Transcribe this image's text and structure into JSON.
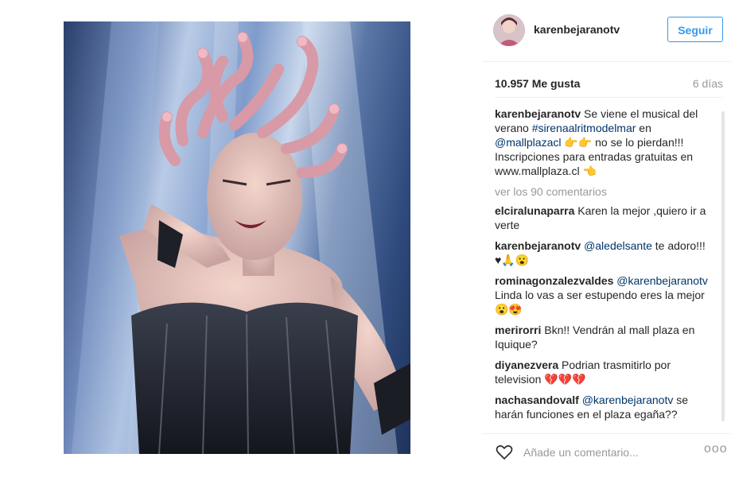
{
  "post": {
    "image_alt": "",
    "author": "karenbejaranotv",
    "follow_label": "Seguir",
    "likes": "10.957 Me gusta",
    "time": "6 días",
    "caption": {
      "user": "karenbejaranotv",
      "t1": " Se viene el musical del verano ",
      "hashtag": "#sirenaalritmodelmar",
      "t2": " en ",
      "mention": "@mallplazacl",
      "t3": " 👉👉 no se lo pierdan!!! Inscripciones para entradas gratuitas en www.mallplaza.cl 👈"
    },
    "view_more": "ver los 90 comentarios",
    "comments": [
      {
        "user": "elciralunaparra",
        "text": " Karen la mejor ,quiero ir a verte"
      },
      {
        "user": "karenbejaranotv",
        "mention": "@aledelsante",
        "text": " te adoro!!! ♥🙏😮"
      },
      {
        "user": "rominagonzalezvaldes",
        "mention": "@karenbejaranotv",
        "text": " Linda lo vas a ser estupendo eres la mejor 😮😍"
      },
      {
        "user": "merirorri",
        "text": " Bkn!! Vendrán al mall plaza en Iquique?"
      },
      {
        "user": "diyanezvera",
        "text": " Podrian trasmitirlo por television 💔💔💔"
      },
      {
        "user": "nachasandovalf",
        "mention": "@karenbejaranotv",
        "text": " se harán funciones en el plaza egaña??"
      }
    ],
    "comment_placeholder": "Añade un comentario...",
    "more_options": "ooo"
  },
  "colors": {
    "accent": "#3897f0",
    "link": "#003569",
    "muted": "#999999"
  },
  "icons": {
    "like": "heart-outline-icon",
    "options": "ellipsis-icon"
  }
}
